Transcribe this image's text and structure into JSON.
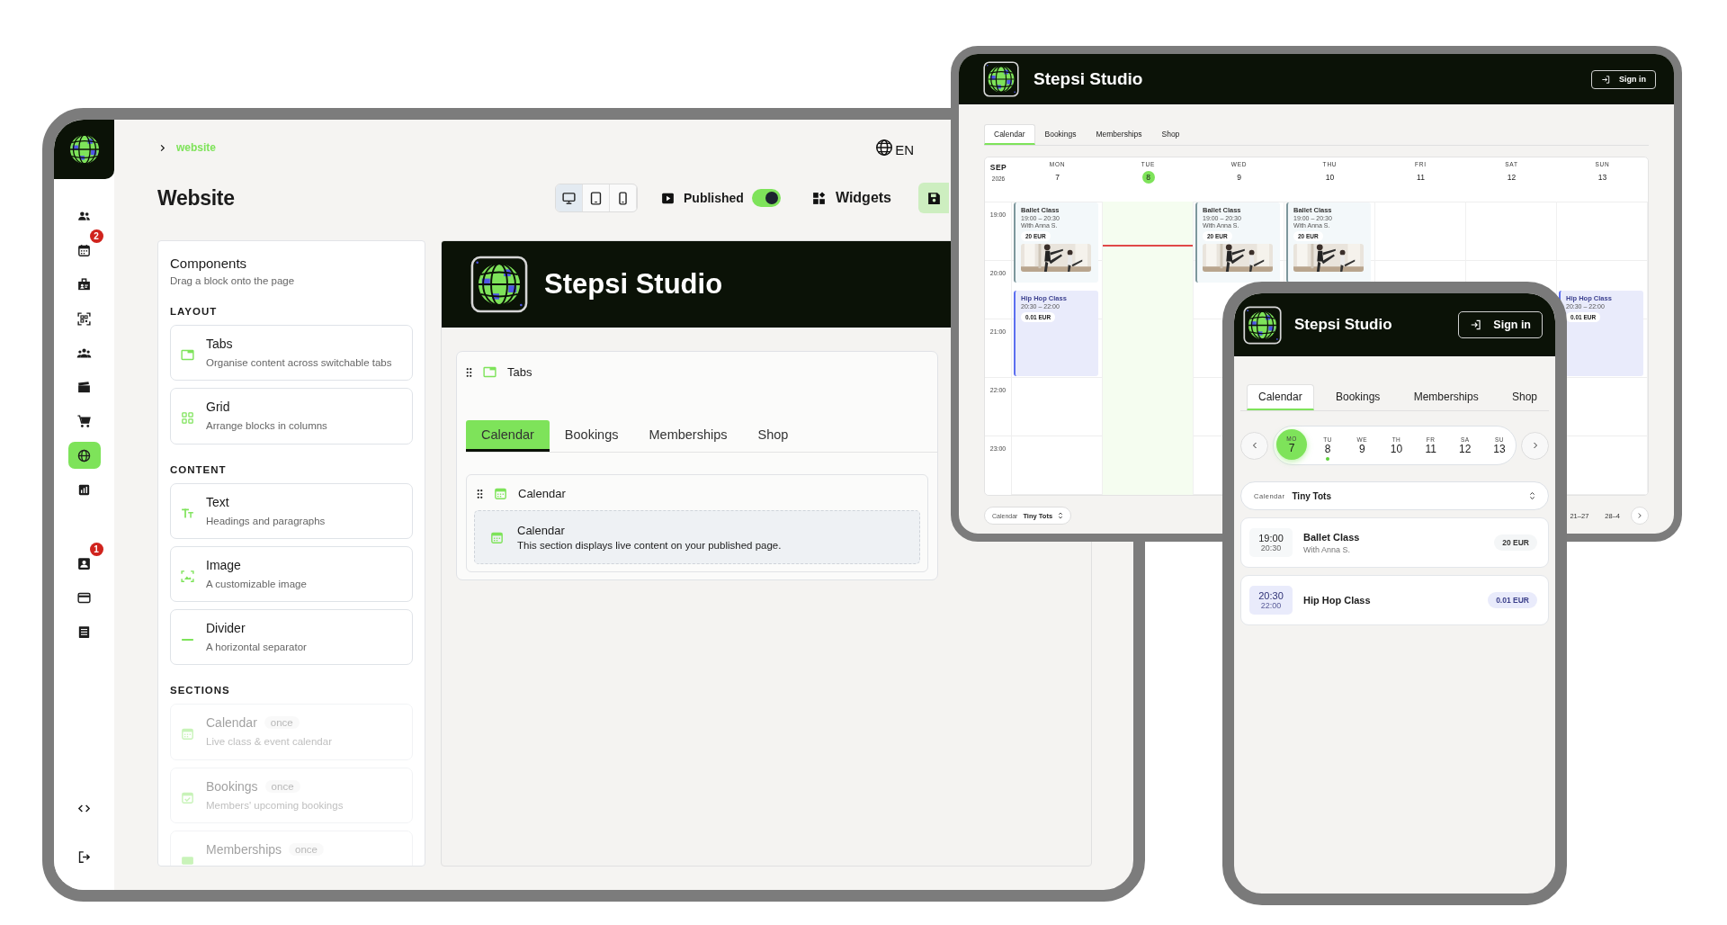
{
  "admin": {
    "sidebar": {
      "main": [
        {
          "selected": false
        },
        {
          "selected": false,
          "badge": "2"
        },
        {
          "selected": false
        },
        {
          "selected": false
        },
        {
          "selected": false
        },
        {
          "selected": false
        },
        {
          "selected": false
        },
        {
          "selected": true
        },
        {
          "selected": false
        }
      ],
      "account": [
        {
          "selected": false,
          "badge": "1"
        },
        {
          "selected": false
        },
        {
          "selected": false
        }
      ],
      "footer": [
        {
          "selected": false
        },
        {
          "selected": false
        }
      ]
    },
    "breadcrumb": "website",
    "language": "EN",
    "title": "Website",
    "view_modes": [
      {
        "selected": true
      },
      {
        "selected": false
      },
      {
        "selected": false
      }
    ],
    "published": {
      "label": "Published",
      "on": true
    },
    "widgets": "Widgets",
    "components": {
      "title": "Components",
      "subtitle": "Drag a block onto the page",
      "groups": [
        {
          "heading": "LAYOUT",
          "items": [
            {
              "name": "Tabs",
              "description": "Organise content across switchable tabs",
              "disabled": false
            },
            {
              "name": "Grid",
              "description": "Arrange blocks in columns",
              "disabled": false
            }
          ]
        },
        {
          "heading": "CONTENT",
          "items": [
            {
              "name": "Text",
              "description": "Headings and paragraphs",
              "disabled": false
            },
            {
              "name": "Image",
              "description": "A customizable image",
              "disabled": false
            },
            {
              "name": "Divider",
              "description": "A horizontal separator",
              "disabled": false
            }
          ]
        },
        {
          "heading": "SECTIONS",
          "items": [
            {
              "name": "Calendar",
              "badge": "once",
              "description": "Live class & event calendar",
              "disabled": true
            },
            {
              "name": "Bookings",
              "badge": "once",
              "description": "Members' upcoming bookings",
              "disabled": true
            },
            {
              "name": "Memberships",
              "badge": "once",
              "disabled": true
            }
          ]
        }
      ]
    },
    "builder": {
      "site_name": "Stepsi Studio",
      "block_label": "Tabs",
      "tabs": [
        {
          "label": "Calendar",
          "selected": true
        },
        {
          "label": "Bookings",
          "selected": false
        },
        {
          "label": "Memberships",
          "selected": false
        },
        {
          "label": "Shop",
          "selected": false
        }
      ],
      "inner_label": "Calendar",
      "placeholder_title": "Calendar",
      "placeholder_text": "This section displays live content on your published page."
    }
  },
  "tablet": {
    "site_name": "Stepsi Studio",
    "sign_in": "Sign in",
    "tabs": [
      {
        "label": "Calendar",
        "selected": true
      },
      {
        "label": "Bookings",
        "selected": false
      },
      {
        "label": "Memberships",
        "selected": false
      },
      {
        "label": "Shop",
        "selected": false
      }
    ],
    "month": "SEP",
    "year": "2026",
    "hours": [
      "19:00",
      "20:00",
      "21:00",
      "22:00",
      "23:00"
    ],
    "days": [
      {
        "weekday": "MON",
        "date": "7",
        "today": false,
        "events": [
          {
            "kind": "ballet",
            "title": "Ballet Class",
            "time": "19:00 – 20:30",
            "teacher": "With Anna S.",
            "price": "20 EUR"
          },
          {
            "kind": "hiphop",
            "title": "Hip Hop Class",
            "time": "20:30 – 22:00",
            "price": "0.01 EUR"
          }
        ]
      },
      {
        "weekday": "TUE",
        "date": "8",
        "today": true
      },
      {
        "weekday": "WED",
        "date": "9",
        "today": false,
        "events": [
          {
            "kind": "ballet",
            "title": "Ballet Class",
            "time": "19:00 – 20:30",
            "teacher": "With Anna S.",
            "price": "20 EUR"
          }
        ]
      },
      {
        "weekday": "THU",
        "date": "10",
        "today": false,
        "events": [
          {
            "kind": "ballet",
            "title": "Ballet Class",
            "time": "19:00 – 20:30",
            "teacher": "With Anna S.",
            "price": "20 EUR"
          }
        ]
      },
      {
        "weekday": "FRI",
        "date": "11",
        "today": false
      },
      {
        "weekday": "SAT",
        "date": "12",
        "today": false
      },
      {
        "weekday": "SUN",
        "date": "13",
        "today": false,
        "events": [
          {
            "kind": "hiphop",
            "title": "Hip Hop Class",
            "time": "20:30 – 22:00",
            "price": "0.01 EUR"
          }
        ]
      }
    ],
    "calendar_select": {
      "label": "Calendar",
      "value": "Tiny Tots"
    },
    "weeks": [
      "21–27",
      "28–4"
    ]
  },
  "phone": {
    "site_name": "Stepsi Studio",
    "sign_in": "Sign in",
    "tabs": [
      {
        "label": "Calendar",
        "selected": true
      },
      {
        "label": "Bookings",
        "selected": false
      },
      {
        "label": "Memberships",
        "selected": false
      },
      {
        "label": "Shop",
        "selected": false
      }
    ],
    "days": [
      {
        "abbr": "MO",
        "date": "7",
        "selected": true,
        "today": false
      },
      {
        "abbr": "TU",
        "date": "8",
        "selected": false,
        "today": true
      },
      {
        "abbr": "WE",
        "date": "9",
        "selected": false,
        "today": false
      },
      {
        "abbr": "TH",
        "date": "10",
        "selected": false,
        "today": false
      },
      {
        "abbr": "FR",
        "date": "11",
        "selected": false,
        "today": false
      },
      {
        "abbr": "SA",
        "date": "12",
        "selected": false,
        "today": false
      },
      {
        "abbr": "SU",
        "date": "13",
        "selected": false,
        "today": false
      }
    ],
    "calendar_select": {
      "label": "Calendar",
      "value": "Tiny Tots"
    },
    "events": [
      {
        "kind": "ballet",
        "start": "19:00",
        "end": "20:30",
        "title": "Ballet Class",
        "teacher": "With Anna S.",
        "price": "20 EUR"
      },
      {
        "kind": "hiphop",
        "start": "20:30",
        "end": "22:00",
        "title": "Hip Hop Class",
        "price": "0.01 EUR"
      }
    ]
  }
}
